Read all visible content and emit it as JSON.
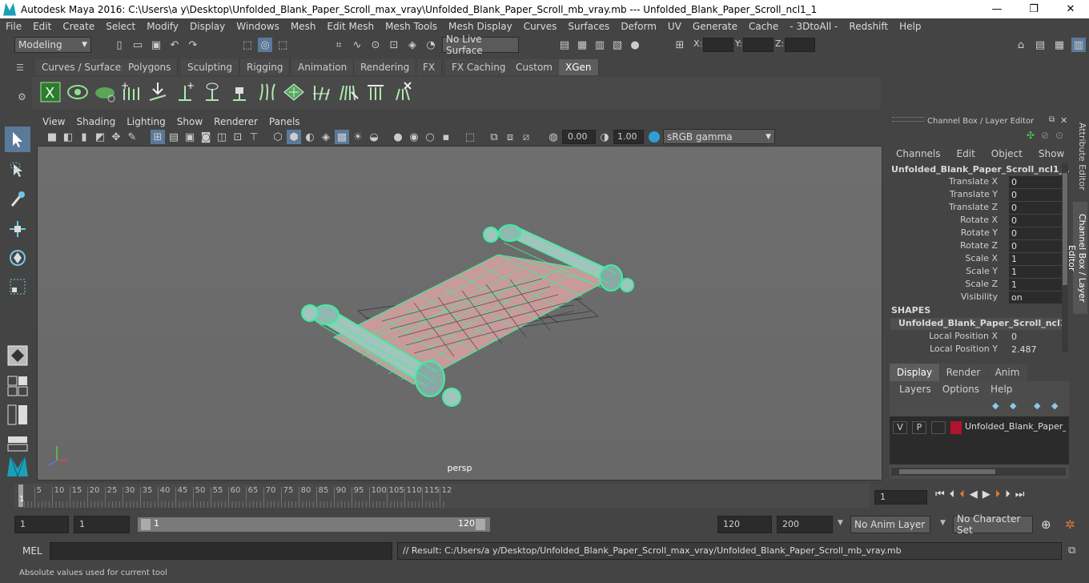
{
  "window": {
    "title": "Autodesk Maya 2016: C:\\Users\\a y\\Desktop\\Unfolded_Blank_Paper_Scroll_max_vray\\Unfolded_Blank_Paper_Scroll_mb_vray.mb   ---   Unfolded_Blank_Paper_Scroll_ncl1_1",
    "minimize": "—",
    "maximize": "❐",
    "close": "✕"
  },
  "menubar": [
    "File",
    "Edit",
    "Create",
    "Select",
    "Modify",
    "Display",
    "Windows",
    "Mesh",
    "Edit Mesh",
    "Mesh Tools",
    "Mesh Display",
    "Curves",
    "Surfaces",
    "Deform",
    "UV",
    "Generate",
    "Cache",
    "- 3DtoAll -",
    "Redshift",
    "Help"
  ],
  "statusline": {
    "mode": "Modeling",
    "live_surface": "No Live Surface",
    "x_label": "X:",
    "y_label": "Y:",
    "z_label": "Z:"
  },
  "shelf_tabs": [
    "Curves / Surfaces",
    "Polygons",
    "Sculpting",
    "Rigging",
    "Animation",
    "Rendering",
    "FX",
    "FX Caching",
    "Custom",
    "XGen"
  ],
  "active_shelf_tab": "XGen",
  "viewport": {
    "menu": [
      "View",
      "Shading",
      "Lighting",
      "Show",
      "Renderer",
      "Panels"
    ],
    "exposure": "0.00",
    "gamma": "1.00",
    "colorspace": "sRGB gamma",
    "camera_label": "persp"
  },
  "channel_box": {
    "header": "Channel Box / Layer Editor",
    "menu": [
      "Channels",
      "Edit",
      "Object",
      "Show"
    ],
    "object_name": "Unfolded_Blank_Paper_Scroll_ncl1_1",
    "attributes": [
      {
        "label": "Translate X",
        "value": "0"
      },
      {
        "label": "Translate Y",
        "value": "0"
      },
      {
        "label": "Translate Z",
        "value": "0"
      },
      {
        "label": "Rotate X",
        "value": "0"
      },
      {
        "label": "Rotate Y",
        "value": "0"
      },
      {
        "label": "Rotate Z",
        "value": "0"
      },
      {
        "label": "Scale X",
        "value": "1"
      },
      {
        "label": "Scale Y",
        "value": "1"
      },
      {
        "label": "Scale Z",
        "value": "1"
      },
      {
        "label": "Visibility",
        "value": "on"
      }
    ],
    "shapes_header": "SHAPES",
    "shape_name": "Unfolded_Blank_Paper_Scroll_ncl1_1...",
    "shape_attributes": [
      {
        "label": "Local Position X",
        "value": "0"
      },
      {
        "label": "Local Position Y",
        "value": "2.487"
      }
    ]
  },
  "layer_editor": {
    "tabs": [
      "Display",
      "Render",
      "Anim"
    ],
    "active_tab": "Display",
    "menu": [
      "Layers",
      "Options",
      "Help"
    ],
    "layer": {
      "v": "V",
      "p": "P",
      "name": "Unfolded_Blank_Paper_S",
      "color": "#b0142c"
    }
  },
  "side_tabs": [
    "Attribute Editor",
    "Channel Box / Layer Editor"
  ],
  "timeline": {
    "ticks": [
      "5",
      "10",
      "15",
      "20",
      "25",
      "30",
      "35",
      "40",
      "45",
      "50",
      "55",
      "60",
      "65",
      "70",
      "75",
      "80",
      "85",
      "90",
      "95",
      "100",
      "105",
      "110",
      "115",
      "12"
    ],
    "start_marker": "1",
    "current_frame": "1"
  },
  "range": {
    "start": "1",
    "playback_start": "1",
    "slider_start": "1",
    "slider_end": "120",
    "playback_end": "120",
    "end": "200",
    "anim_layer": "No Anim Layer",
    "character_set": "No Character Set"
  },
  "command": {
    "label": "MEL",
    "result": "// Result: C:/Users/a y/Desktop/Unfolded_Blank_Paper_Scroll_max_vray/Unfolded_Blank_Paper_Scroll_mb_vray.mb"
  },
  "helpline": "Absolute values used for current tool",
  "colors": {
    "wire": "#3cf0a0",
    "paper": "#c89a9a",
    "accent": "#5ab4d6"
  }
}
